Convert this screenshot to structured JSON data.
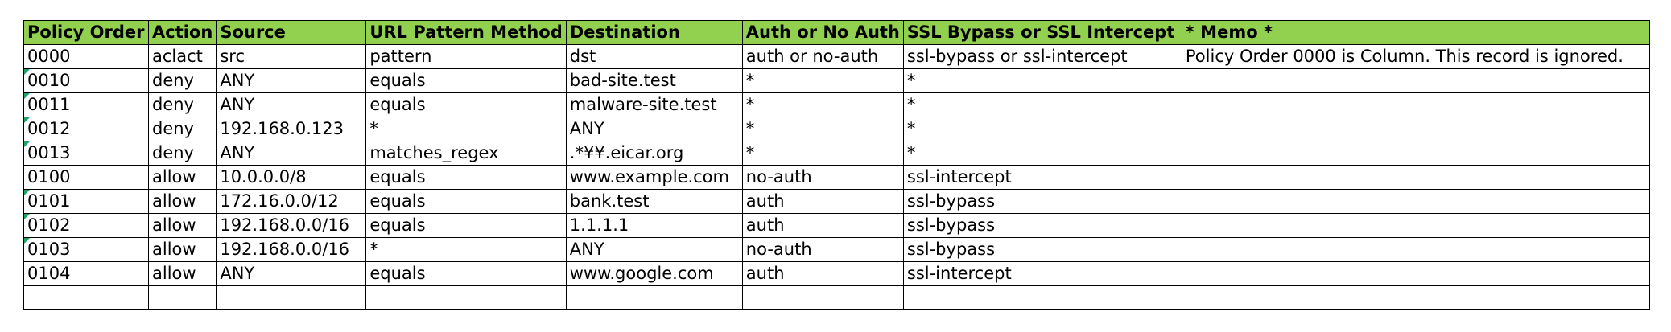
{
  "table": {
    "columns": [
      "Policy Order",
      "Action",
      "Source",
      "URL Pattern Method",
      "Destination",
      "Auth or No Auth",
      "SSL Bypass or SSL Intercept",
      "* Memo *"
    ],
    "rows": [
      [
        "0000",
        "aclact",
        "src",
        "pattern",
        "dst",
        "auth or no-auth",
        "ssl-bypass or ssl-intercept",
        "Policy Order 0000 is Column. This record is ignored."
      ],
      [
        "0010",
        "deny",
        "ANY",
        "equals",
        "bad-site.test",
        "*",
        "*",
        ""
      ],
      [
        "0011",
        "deny",
        "ANY",
        "equals",
        "malware-site.test",
        "*",
        "*",
        ""
      ],
      [
        "0012",
        "deny",
        "192.168.0.123",
        "*",
        "ANY",
        "*",
        "*",
        ""
      ],
      [
        "0013",
        "deny",
        "ANY",
        "matches_regex",
        ".*¥¥.eicar.org",
        "*",
        "*",
        ""
      ],
      [
        "0100",
        "allow",
        "10.0.0.0/8",
        "equals",
        "www.example.com",
        "no-auth",
        "ssl-intercept",
        ""
      ],
      [
        "0101",
        "allow",
        "172.16.0.0/12",
        "equals",
        "bank.test",
        "auth",
        "ssl-bypass",
        ""
      ],
      [
        "0102",
        "allow",
        "192.168.0.0/16",
        "equals",
        "1.1.1.1",
        "auth",
        "ssl-bypass",
        ""
      ],
      [
        "0103",
        "allow",
        "192.168.0.0/16",
        "*",
        "ANY",
        "no-auth",
        "ssl-bypass",
        ""
      ],
      [
        "0104",
        "allow",
        "ANY",
        "equals",
        "www.google.com",
        "auth",
        "ssl-intercept",
        ""
      ],
      [
        "",
        "",
        "",
        "",
        "",
        "",
        "",
        ""
      ]
    ],
    "marked_rows": [
      false,
      true,
      true,
      true,
      true,
      false,
      true,
      true,
      true,
      false,
      false
    ]
  },
  "colors": {
    "header_fill": "#92d050",
    "border": "#000000",
    "marker": "#21a366"
  }
}
